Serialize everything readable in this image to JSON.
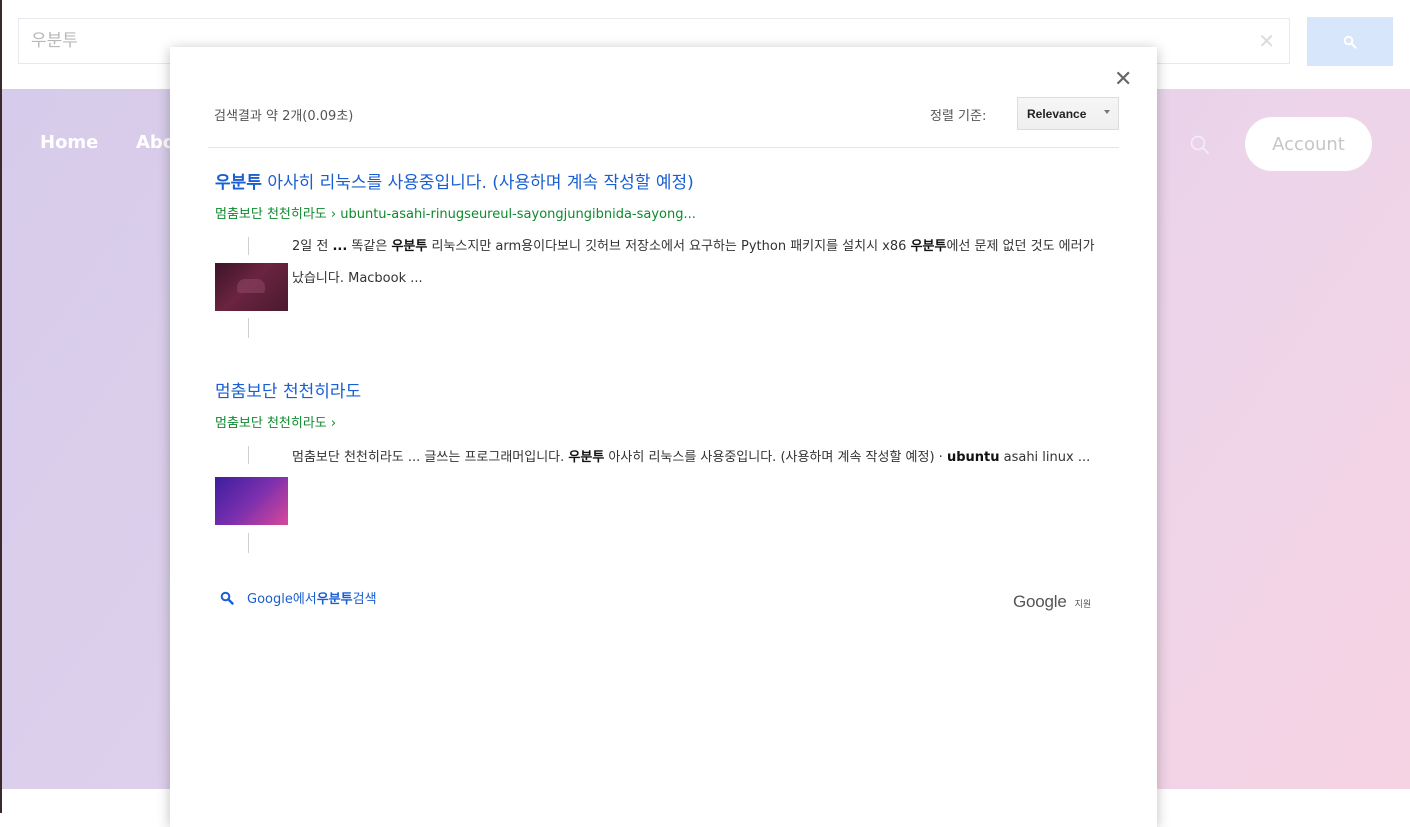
{
  "search": {
    "value": "우분투",
    "clear_icon": "close-icon",
    "button_icon": "search-icon"
  },
  "nav": {
    "home": "Home",
    "about": "Abo",
    "account": "Account",
    "search_icon": "search-icon"
  },
  "modal": {
    "result_info": "검색결과 약 2개(0.09초)",
    "sort_label": "정렬 기준:",
    "sort_value": "Relevance",
    "results": [
      {
        "title_bold": "우분투",
        "title_rest": " 아사히 리눅스를 사용중입니다. (사용하며 계속 작성할 예정)",
        "url": "멈춤보단 천천히라도 › ubuntu-asahi-rinugseureul-sayongjungibnida-sayong...",
        "snippet_a": "2일 전 ",
        "snippet_b": "...",
        "snippet_c": " 똑같은 ",
        "snippet_d": "우분투",
        "snippet_e": " 리눅스지만 arm용이다보니 깃허브 저장소에서 요구하는 Python 패키지를 설치시 x86 ",
        "snippet_f": "우분투",
        "snippet_g": "에선 문제 없던 것도 에러가 났습니다. Macbook ..."
      },
      {
        "title": "멈춤보단 천천히라도",
        "url": "멈춤보단 천천히라도 ›",
        "snippet_a": "멈춤보단 천천히라도 ... 글쓰는 프로그래머입니다. ",
        "snippet_b": "우분투",
        "snippet_c": " 아사히 리눅스를 사용중입니다. (사용하며 계속 작성할 예정) · ",
        "snippet_d": "ubuntu",
        "snippet_e": " asahi linux ..."
      }
    ],
    "google_link_a": "Google에서 ",
    "google_link_b": "우분투",
    "google_link_c": " 검색",
    "powered_logo": "Google",
    "powered_sub": "지원"
  },
  "colors": {
    "link": "#1a5fd1",
    "url": "#0c8a2c",
    "search_button": "#d7e6fb"
  }
}
